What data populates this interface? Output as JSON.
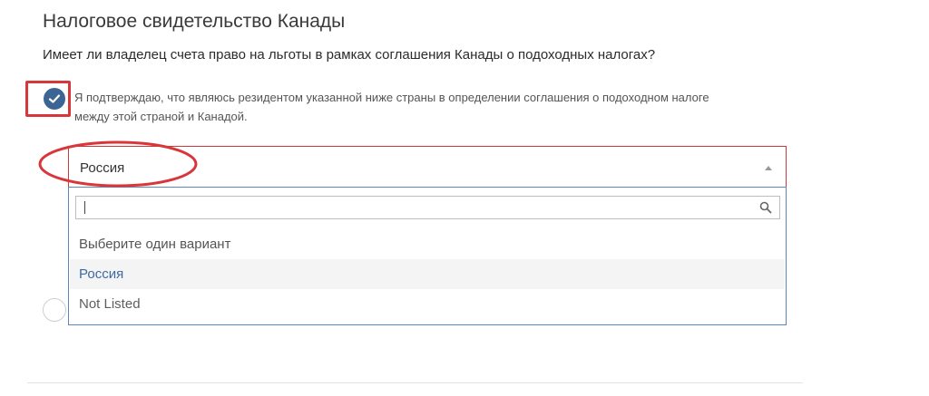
{
  "section": {
    "title": "Налоговое свидетельство Канады",
    "question": "Имеет ли владелец счета право на льготы в рамках соглашения Канады о подоходных налогах?"
  },
  "confirmation": {
    "checked": true,
    "text": "Я подтверждаю, что являюсь резидентом указанной ниже страны в определении соглашения о подоходном налоге между этой страной и Канадой."
  },
  "country_select": {
    "selected_value": "Россия",
    "expanded": true,
    "search": {
      "value": "",
      "placeholder": ""
    },
    "options": [
      {
        "label": "Выберите один вариант"
      },
      {
        "label": "Россия",
        "highlighted": true
      },
      {
        "label": "Not Listed"
      }
    ]
  },
  "colors": {
    "accent": "#3c6593",
    "annotation_red": "#d9363a",
    "focus_blue": "#5b86b8",
    "highlight_text": "#3d6aa3"
  }
}
